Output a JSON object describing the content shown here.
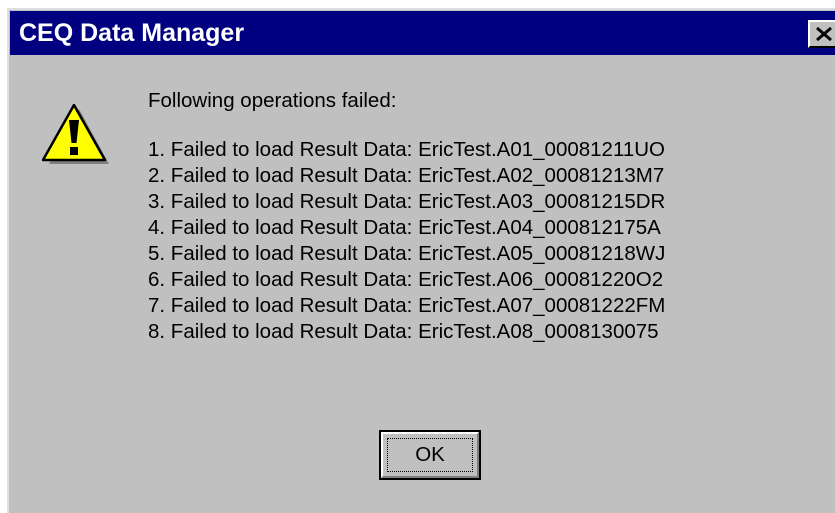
{
  "window": {
    "title": "CEQ Data Manager",
    "close_icon": "close-icon"
  },
  "icon": "warning-icon",
  "message": {
    "heading": "Following operations failed:",
    "items": [
      "1. Failed to load Result Data: EricTest.A01_00081211UO",
      "2. Failed to load Result Data: EricTest.A02_00081213M7",
      "3. Failed to load Result Data: EricTest.A03_00081215DR",
      "4. Failed to load Result Data: EricTest.A04_000812175A",
      "5. Failed to load Result Data: EricTest.A05_00081218WJ",
      "6. Failed to load Result Data: EricTest.A06_00081220O2",
      "7. Failed to load Result Data: EricTest.A07_00081222FM",
      "8. Failed to load Result Data: EricTest.A08_0008130075"
    ]
  },
  "buttons": {
    "ok_label": "OK"
  },
  "colors": {
    "titlebar": "#000080",
    "face": "#c0c0c0",
    "warning_fill": "#ffff00"
  }
}
